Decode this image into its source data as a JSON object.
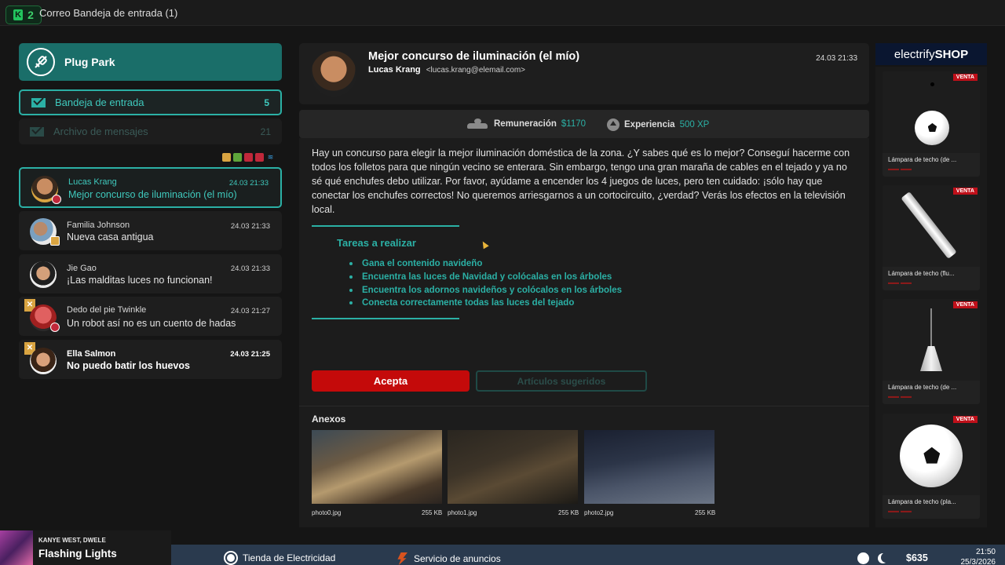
{
  "app": {
    "badge_number": "2",
    "title": "Correo Bandeja de entrada (1)"
  },
  "sidebar": {
    "brand": "Plug Park",
    "folders": [
      {
        "label": "Bandeja de entrada",
        "count": "5"
      },
      {
        "label": "Archivo de mensajes",
        "count": "21"
      }
    ],
    "messages": [
      {
        "sender": "Lucas Krang",
        "subject": "Mejor concurso de iluminación (el mío)",
        "time": "24.03 21:33"
      },
      {
        "sender": "Familia Johnson",
        "subject": "Nueva casa antigua",
        "time": "24.03 21:33"
      },
      {
        "sender": "Jie Gao",
        "subject": "¡Las malditas luces no funcionan!",
        "time": "24.03 21:33"
      },
      {
        "sender": "Dedo del pie Twinkle",
        "subject": "Un robot así no es un cuento de hadas",
        "time": "24.03 21:27"
      },
      {
        "sender": "Ella Salmon",
        "subject": "No puedo batir los huevos",
        "time": "24.03 21:25"
      }
    ]
  },
  "mail": {
    "subject": "Mejor concurso de iluminación (el mío)",
    "from_name": "Lucas Krang",
    "from_email": "<lucas.krang@elemail.com>",
    "date": "24.03 21:33",
    "reward_label": "Remuneración",
    "reward_value": "$1170",
    "xp_label": "Experiencia",
    "xp_value": "500 XP",
    "body": "Hay un concurso para elegir la mejor iluminación doméstica de la zona. ¿Y sabes qué es lo mejor? Conseguí hacerme con todos los folletos para que ningún vecino se enterara. Sin embargo, tengo una gran maraña de cables en el tejado y ya no sé qué enchufes debo utilizar. Por favor, ayúdame a encender los 4 juegos de luces, pero ten cuidado: ¡sólo hay que conectar los enchufes correctos! No queremos arriesgarnos a un cortocircuito, ¿verdad? Verás los efectos en la televisión local.",
    "tasks_title": "Tareas a realizar",
    "tasks": [
      "Gana el contenido navideño",
      "Encuentra las luces de Navidad y colócalas en los árboles",
      "Encuentra los adornos navideños y colócalos en los árboles",
      "Conecta correctamente todas las luces del tejado"
    ],
    "accept_label": "Acepta",
    "suggested_label": "Artículos sugeridos",
    "attachments_title": "Anexos",
    "attachments": [
      {
        "name": "photo0.jpg",
        "size": "255 KB"
      },
      {
        "name": "photo1.jpg",
        "size": "255 KB"
      },
      {
        "name": "photo2.jpg",
        "size": "255 KB"
      }
    ]
  },
  "shop": {
    "logo_light": "electrify",
    "logo_bold": "SHOP",
    "sale_label": "VENTA",
    "products": [
      {
        "name": "Lámpara de techo (de ..."
      },
      {
        "name": "Lámpara de techo (flu..."
      },
      {
        "name": "Lámpara de techo (de ..."
      },
      {
        "name": "Lámpara de techo (pla..."
      }
    ]
  },
  "music": {
    "artist": "KANYE WEST, DWELE",
    "title": "Flashing Lights"
  },
  "taskbar": {
    "electricity_store": "Tienda de Electricidad",
    "ads_service": "Servicio de anuncios",
    "money": "$635",
    "time": "21:50",
    "date": "25/3/2026"
  },
  "colors": {
    "accent": "#2bb0a5",
    "brand_bg": "#1a6e69",
    "accept": "#c40a0a",
    "sale": "#c0101a"
  }
}
